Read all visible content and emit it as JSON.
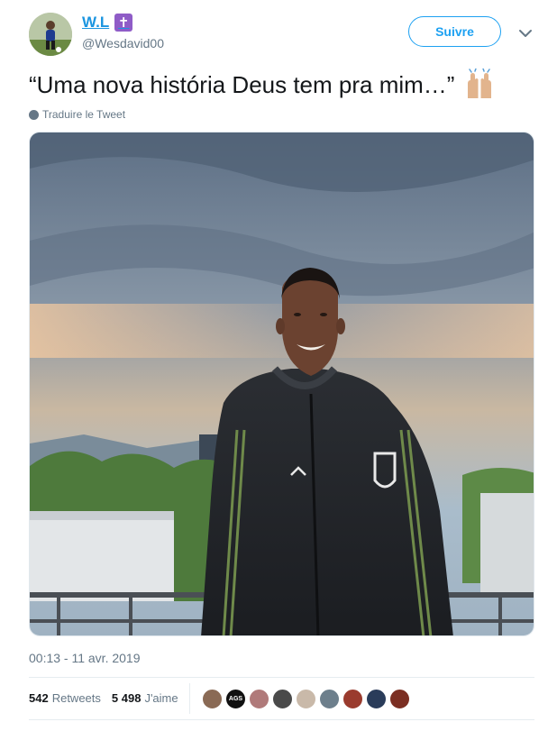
{
  "author": {
    "display_name": "W.L",
    "badge_symbol": "✝",
    "handle": "@Wesdavid00"
  },
  "header": {
    "follow_label": "Suivre"
  },
  "tweet": {
    "text": "“Uma nova história Deus tem pra mim…”",
    "emoji": "raised-hands-medium-light-skin",
    "translate_label": "Traduire le Tweet",
    "timestamp": "00:13 - 11 avr. 2019"
  },
  "stats": {
    "retweets_count": "542",
    "retweets_label": "Retweets",
    "likes_count": "5 498",
    "likes_label": "J'aime"
  },
  "likers": [
    {
      "color": "#8a6a55",
      "label": ""
    },
    {
      "color": "#111111",
      "label": "AGS"
    },
    {
      "color": "#b07a7a",
      "label": ""
    },
    {
      "color": "#4a4a4a",
      "label": ""
    },
    {
      "color": "#c9b9a9",
      "label": ""
    },
    {
      "color": "#6d7f8c",
      "label": ""
    },
    {
      "color": "#9a3b2e",
      "label": ""
    },
    {
      "color": "#2a3c5a",
      "label": ""
    },
    {
      "color": "#7b2e22",
      "label": ""
    }
  ],
  "colors": {
    "link": "#1b95e0",
    "accent": "#1da1f2",
    "muted": "#657786",
    "badge": "#8f5cc7"
  }
}
